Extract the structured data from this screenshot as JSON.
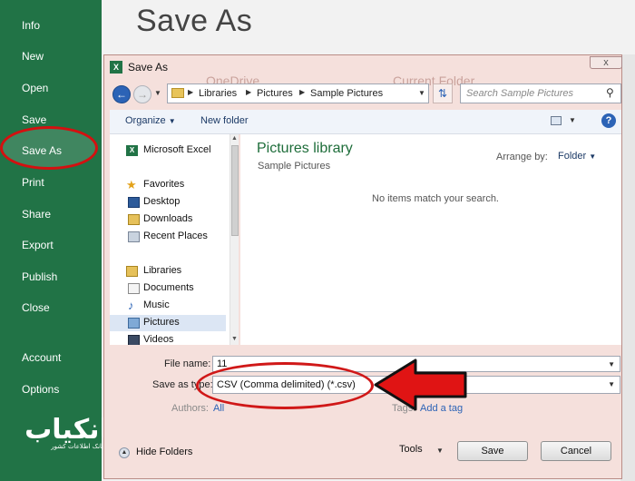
{
  "backstage": {
    "items": [
      "Info",
      "New",
      "Open",
      "Save",
      "Save As",
      "Print",
      "Share",
      "Export",
      "Publish",
      "Close",
      "Account",
      "Options"
    ],
    "selected": "Save As",
    "watermark_main": "بانکیاب",
    "watermark_sub": "مرجع بانک اطلاعات کشور"
  },
  "page": {
    "heading": "Save As",
    "ghost_left": "OneDrive",
    "ghost_right": "Current Folder"
  },
  "dialog": {
    "title": "Save As",
    "close_glyph": "x",
    "address_path": [
      "Libraries",
      "Pictures",
      "Sample Pictures"
    ],
    "search_placeholder": "Search Sample Pictures",
    "toolbar": {
      "organize": "Organize",
      "new_folder": "New folder"
    },
    "nav_pane": {
      "items": [
        {
          "label": "Microsoft Excel",
          "icon": "excel-icon"
        },
        {
          "label": "Favorites",
          "icon": "star-icon"
        },
        {
          "label": "Desktop",
          "icon": "desktop-icon"
        },
        {
          "label": "Downloads",
          "icon": "downloads-icon"
        },
        {
          "label": "Recent Places",
          "icon": "recent-places-icon"
        },
        {
          "label": "Libraries",
          "icon": "libraries-icon"
        },
        {
          "label": "Documents",
          "icon": "documents-icon"
        },
        {
          "label": "Music",
          "icon": "music-icon"
        },
        {
          "label": "Pictures",
          "icon": "pictures-icon"
        },
        {
          "label": "Videos",
          "icon": "videos-icon"
        }
      ],
      "selected": "Pictures"
    },
    "content": {
      "title": "Pictures library",
      "subtitle": "Sample Pictures",
      "arrange_label": "Arrange by:",
      "arrange_value": "Folder",
      "empty_message": "No items match your search."
    },
    "form": {
      "file_name_label": "File name:",
      "file_name_value": "11",
      "save_type_label": "Save as type:",
      "save_type_value": "CSV (Comma delimited) (*.csv)",
      "authors_label": "Authors:",
      "authors_value": "All",
      "tags_label": "Tags:",
      "tags_value": "Add a tag"
    },
    "footer": {
      "hide_folders": "Hide Folders",
      "tools": "Tools",
      "save": "Save",
      "cancel": "Cancel"
    }
  },
  "colors": {
    "excel_green": "#217346",
    "highlight_red": "#d01818",
    "dialog_tint": "#f5e0dc"
  }
}
